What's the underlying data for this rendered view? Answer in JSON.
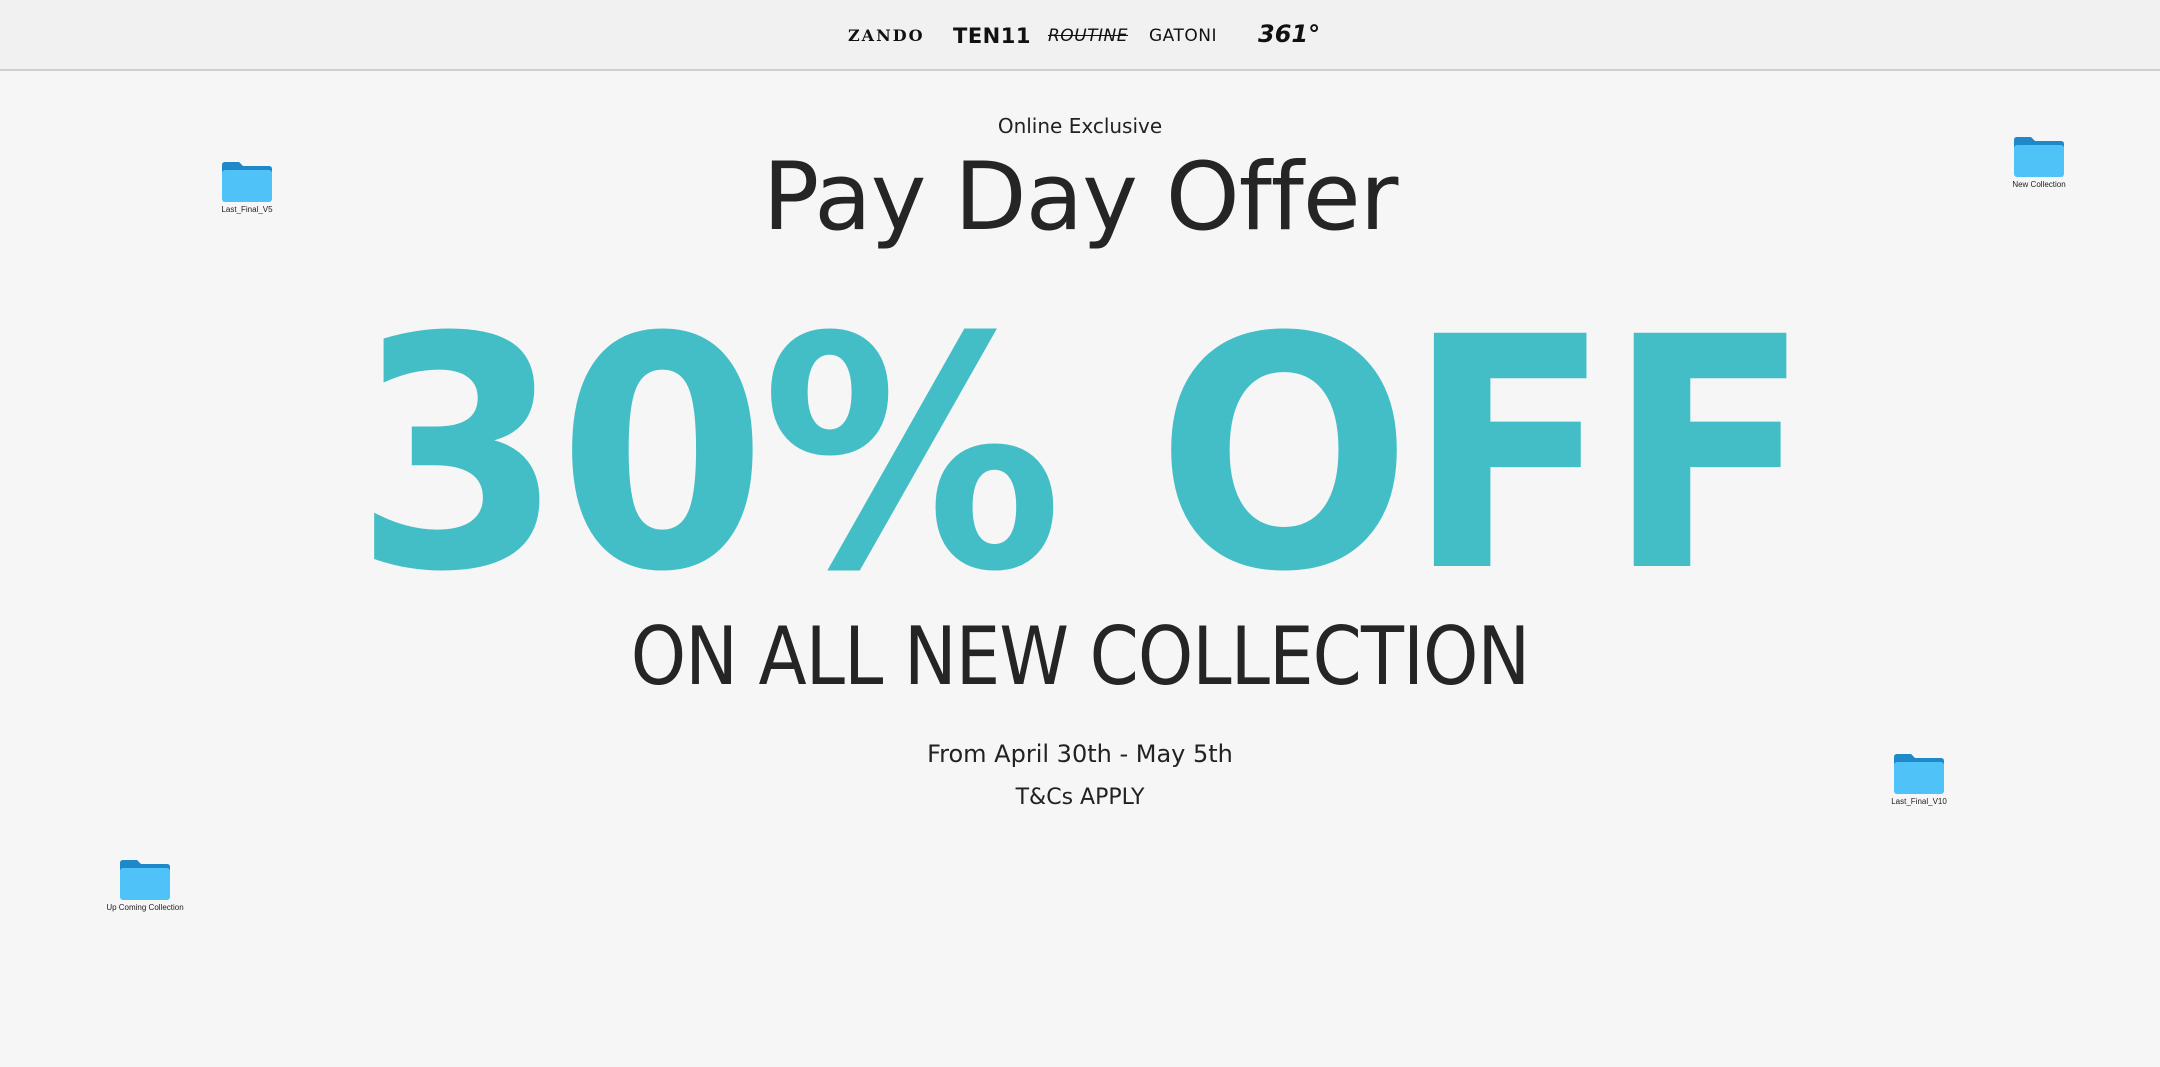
{
  "header": {
    "brands": [
      "ZANDO",
      "TEN11",
      "ROUTINE",
      "GATONI",
      "361°"
    ]
  },
  "banner": {
    "eyebrow": "Online Exclusive",
    "title": "Pay Day Offer",
    "discount": "30% OFF",
    "subtitle": "ON ALL NEW COLLECTION",
    "dates": "From April 30th - May 5th",
    "terms": "T&Cs APPLY",
    "accent_color": "#44bec6"
  },
  "desktop": {
    "folders": [
      {
        "label": "Last_Final_V5",
        "icon": "folder-icon"
      },
      {
        "label": "New Collection",
        "icon": "folder-icon"
      },
      {
        "label": "Last_Final_V10",
        "icon": "folder-icon"
      },
      {
        "label": "Up Coming Collection",
        "icon": "folder-icon"
      }
    ],
    "folder_color": "#4fc3f7"
  }
}
